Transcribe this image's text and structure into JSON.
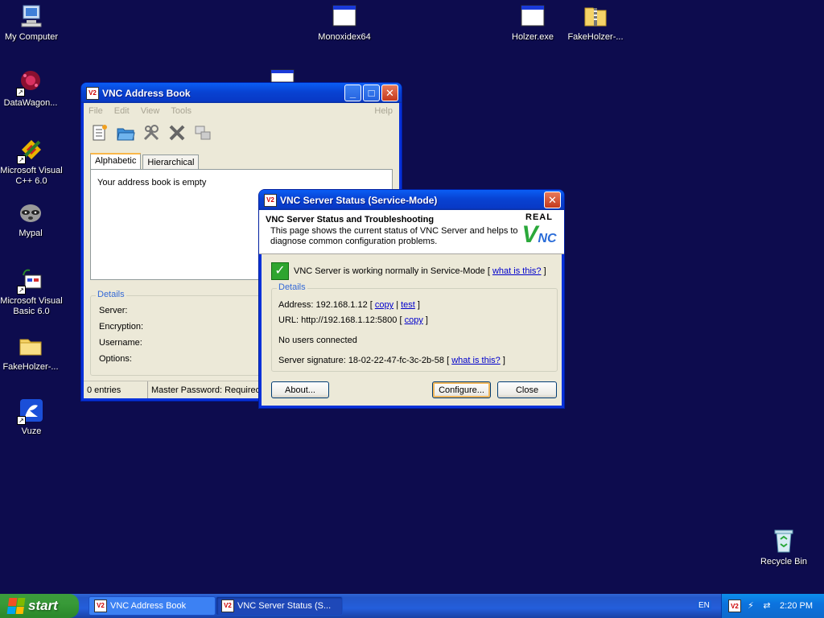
{
  "desktop": {
    "icons": [
      {
        "label": "My Computer"
      },
      {
        "label": "DataWagon..."
      },
      {
        "label": "Microsoft Visual C++ 6.0"
      },
      {
        "label": "Mypal"
      },
      {
        "label": "Microsoft Visual Basic 6.0"
      },
      {
        "label": "FakeHolzer-..."
      },
      {
        "label": "Vuze"
      },
      {
        "label": "Monoxidex64"
      },
      {
        "label": "Holzer.exe"
      },
      {
        "label": "FakeHolzer-..."
      },
      {
        "label": "Recycle Bin"
      }
    ]
  },
  "address_book": {
    "title": "VNC Address Book",
    "menu": [
      "File",
      "Edit",
      "View",
      "Tools",
      "Help"
    ],
    "tabs": [
      "Alphabetic",
      "Hierarchical"
    ],
    "empty_text": "Your address book is empty",
    "details_legend": "Details",
    "details_fields": [
      "Server:",
      "Encryption:",
      "Username:",
      "Options:"
    ],
    "status_entries": "0 entries",
    "status_password": "Master Password: Required"
  },
  "vnc_status": {
    "title": "VNC Server Status (Service-Mode)",
    "header_title": "VNC Server Status and Troubleshooting",
    "header_desc": "This page shows the current status of VNC Server and helps to diagnose common configuration problems.",
    "logo_top": "REAL",
    "logo_v": "V",
    "logo_nc": "NC",
    "ok_text": "VNC Server is working normally in Service-Mode [",
    "ok_link": "what is this?",
    "ok_close": "]",
    "details_legend": "Details",
    "address_text": "Address: 192.168.1.12 [",
    "address_copy": "copy",
    "address_sep": "|",
    "address_test": "test",
    "address_close": "]",
    "url_text": "URL: http://192.168.1.12:5800 [",
    "url_copy": "copy",
    "url_close": "]",
    "users_text": "No users connected",
    "signature_text": "Server signature: 18-02-22-47-fc-3c-2b-58 [",
    "signature_link": "what is this?",
    "signature_close": "]",
    "btn_about": "About...",
    "btn_configure": "Configure...",
    "btn_close": "Close"
  },
  "taskbar": {
    "start_label": "start",
    "tasks": [
      "VNC Address Book",
      "VNC Server Status (S..."
    ],
    "language": "EN",
    "clock": "2:20 PM"
  },
  "colors": {
    "desktop": "#0d0c4e",
    "window_face": "#ece9d8",
    "titlebar": "#0842d2",
    "link": "#0000cc",
    "vnc_green": "#2aa83a"
  }
}
